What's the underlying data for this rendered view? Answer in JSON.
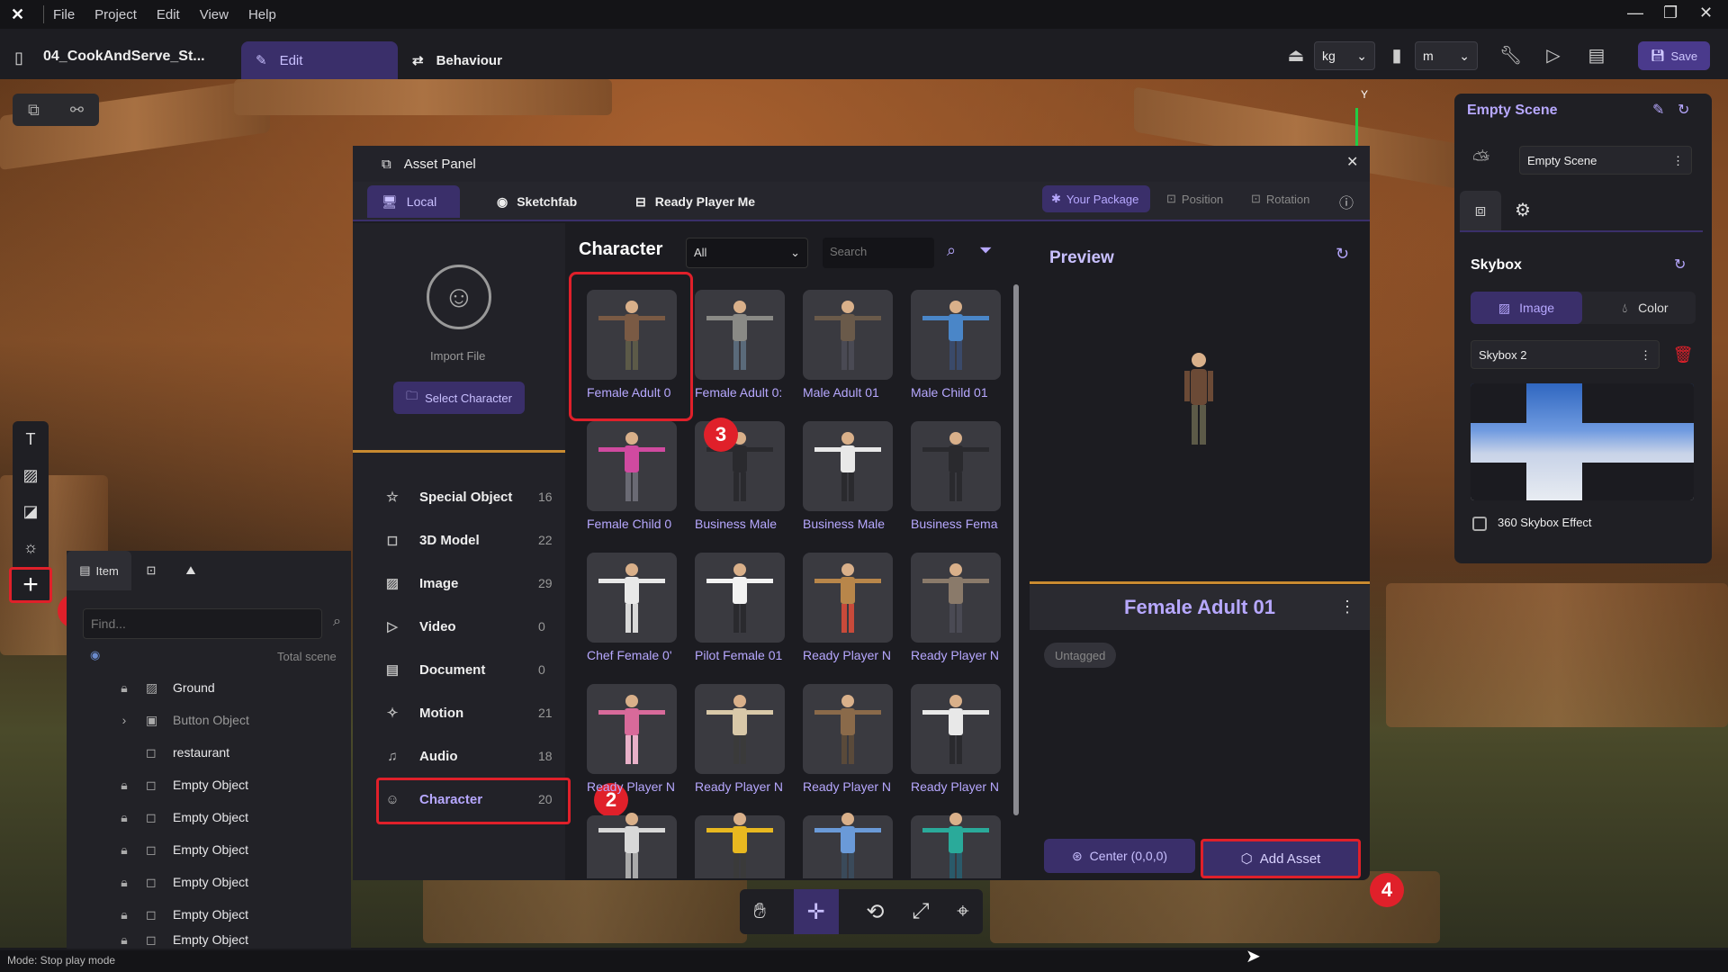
{
  "menu": {
    "items": [
      "File",
      "Project",
      "Edit",
      "View",
      "Help"
    ]
  },
  "project": {
    "title": "04_CookAndServe_St..."
  },
  "tabs": {
    "edit": "Edit",
    "behaviour": "Behaviour"
  },
  "toolbar": {
    "mass_unit": "kg",
    "length_unit": "m",
    "save": "Save"
  },
  "left_panel": {
    "tabs": {
      "item": "Item"
    },
    "find_placeholder": "Find...",
    "total_label": "Total scene",
    "rows": [
      "Ground",
      "Button Object",
      "restaurant",
      "Empty Object",
      "Empty Object",
      "Empty Object",
      "Empty Object",
      "Empty Object",
      "Empty Object"
    ]
  },
  "asset_panel": {
    "title": "Asset Panel",
    "tabs": {
      "local": "Local",
      "sketchfab": "Sketchfab",
      "rpm": "Ready Player Me"
    },
    "your_package": "Your Package",
    "position": "Position",
    "rotation": "Rotation",
    "import_file": "Import File",
    "select_character": "Select Character",
    "categories": [
      {
        "name": "Special Object",
        "count": "16",
        "icon": "star-icon"
      },
      {
        "name": "3D Model",
        "count": "22",
        "icon": "cube-icon"
      },
      {
        "name": "Image",
        "count": "29",
        "icon": "image-icon"
      },
      {
        "name": "Video",
        "count": "0",
        "icon": "play-icon"
      },
      {
        "name": "Document",
        "count": "0",
        "icon": "document-icon"
      },
      {
        "name": "Motion",
        "count": "21",
        "icon": "motion-icon"
      },
      {
        "name": "Audio",
        "count": "18",
        "icon": "audio-icon"
      },
      {
        "name": "Character",
        "count": "20",
        "icon": "character-icon"
      }
    ],
    "grid_title": "Character",
    "filter_value": "All",
    "search_placeholder": "Search",
    "items": [
      "Female Adult 0",
      "Female Adult 0:",
      "Male Adult 01",
      "Male Child 01",
      "Female Child 0",
      "Business Male",
      "Business Male",
      "Business Fema",
      "Chef Female 0'",
      "Pilot Female 01",
      "Ready Player N",
      "Ready Player N",
      "Ready Player N",
      "Ready Player N",
      "Ready Player N",
      "Ready Player N",
      "",
      "",
      "",
      ""
    ],
    "preview_title": "Preview",
    "preview_name": "Female Adult 01",
    "tag": "Untagged",
    "center": "Center (0,0,0)",
    "add_asset": "Add Asset"
  },
  "scene_panel": {
    "title": "Empty Scene",
    "scene_select": "Empty Scene",
    "skybox": "Skybox",
    "image": "Image",
    "color": "Color",
    "skybox_select": "Skybox 2",
    "skybox_360": "360 Skybox Effect"
  },
  "annotations": {
    "b1": "1",
    "b2": "2",
    "b3": "3",
    "b4": "4"
  },
  "axis": {
    "y": "Y"
  },
  "status": "Mode: Stop play mode",
  "colors": {
    "accent": "#3a2f6a",
    "accent_text": "#b7a8ff",
    "highlight": "#e0202a"
  }
}
